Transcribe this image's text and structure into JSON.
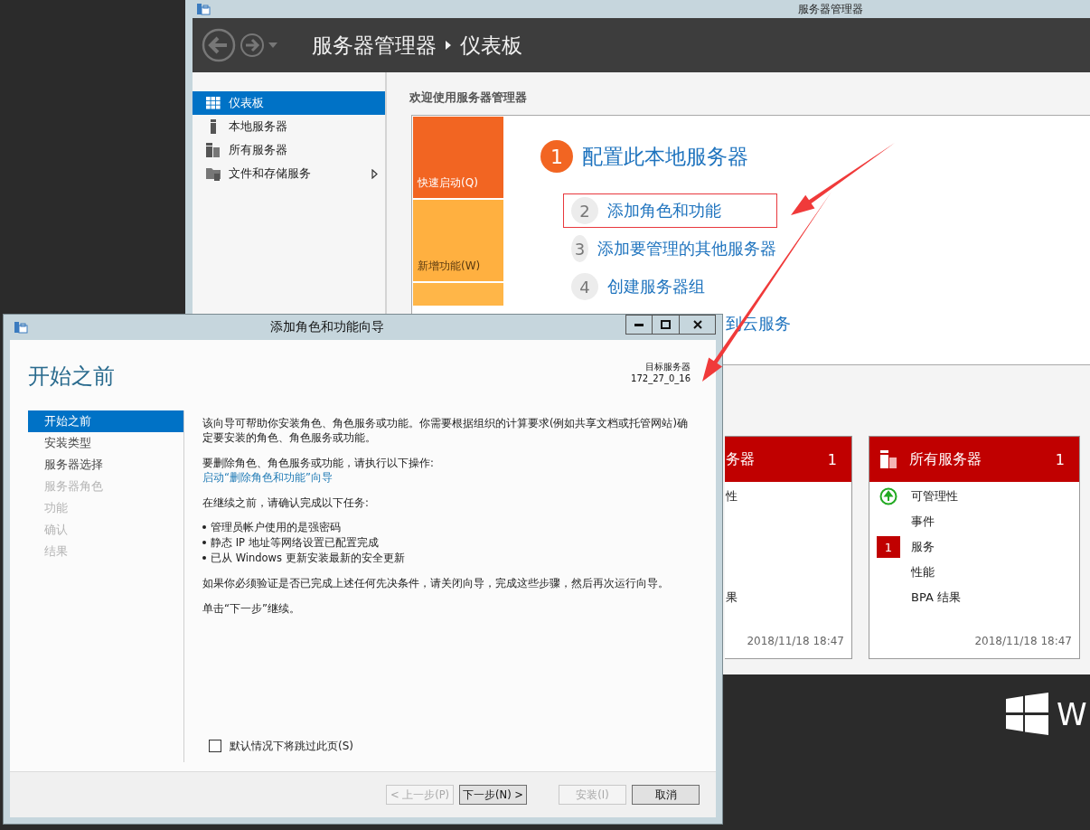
{
  "server_manager": {
    "title": "服务器管理器",
    "breadcrumb": [
      "服务器管理器",
      "仪表板"
    ],
    "sidebar": {
      "items": [
        {
          "label": "仪表板",
          "selected": true,
          "expandable": false
        },
        {
          "label": "本地服务器",
          "selected": false,
          "expandable": false
        },
        {
          "label": "所有服务器",
          "selected": false,
          "expandable": false
        },
        {
          "label": "文件和存储服务",
          "selected": false,
          "expandable": true
        }
      ]
    },
    "welcome_title": "欢迎使用服务器管理器",
    "quick_start": {
      "tiles": [
        {
          "label": "快速启动(Q)",
          "color": "#f26522"
        },
        {
          "label": "新增功能(W)",
          "color": "#ffb040"
        },
        {
          "color": "#ffb648",
          "partial": true
        }
      ],
      "steps": [
        {
          "kind": "primary",
          "number": "1",
          "label": "配置此本地服务器",
          "highlighted": false
        },
        {
          "kind": "secondary",
          "number": "2",
          "label": "添加角色和功能",
          "highlighted": true
        },
        {
          "kind": "secondary",
          "number": "3",
          "label": "添加要管理的其他服务器",
          "highlighted": false
        },
        {
          "kind": "secondary",
          "number": "4",
          "label": "创建服务器组",
          "highlighted": false
        },
        {
          "kind": "covered",
          "label": "到云服务",
          "highlighted": false
        }
      ]
    },
    "tiles": [
      {
        "title": "务器",
        "count": "1",
        "partial": true,
        "items": [
          {
            "kind": "text",
            "label": "性"
          },
          {
            "kind": "blank"
          },
          {
            "kind": "blank"
          },
          {
            "kind": "blank"
          },
          {
            "kind": "text",
            "label": "果"
          }
        ],
        "time": "2018/11/18 18:47"
      },
      {
        "title": "所有服务器",
        "count": "1",
        "partial": false,
        "items": [
          {
            "kind": "status",
            "label": "可管理性"
          },
          {
            "kind": "text",
            "label": "事件"
          },
          {
            "kind": "badge",
            "badge": "1",
            "label": "服务"
          },
          {
            "kind": "text",
            "label": "性能"
          },
          {
            "kind": "text",
            "label": "BPA 结果"
          }
        ],
        "time": "2018/11/18 18:47"
      }
    ]
  },
  "wizard": {
    "title": "添加角色和功能向导",
    "heading": "开始之前",
    "target_label": "目标服务器",
    "target_value": "172_27_0_16",
    "steps": [
      {
        "label": "开始之前",
        "selected": true,
        "disabled": false
      },
      {
        "label": "安装类型",
        "selected": false,
        "disabled": false
      },
      {
        "label": "服务器选择",
        "selected": false,
        "disabled": false
      },
      {
        "label": "服务器角色",
        "selected": false,
        "disabled": true
      },
      {
        "label": "功能",
        "selected": false,
        "disabled": true
      },
      {
        "label": "确认",
        "selected": false,
        "disabled": true
      },
      {
        "label": "结果",
        "selected": false,
        "disabled": true
      }
    ],
    "content": [
      {
        "kind": "paragraph",
        "text": "该向导可帮助你安装角色、角色服务或功能。你需要根据组织的计算要求(例如共享文档或托管网站)确定要安装的角色、角色服务或功能。"
      },
      {
        "kind": "paragraph",
        "text": "要删除角色、角色服务或功能，请执行以下操作:"
      },
      {
        "kind": "link",
        "text": "启动“删除角色和功能”向导"
      },
      {
        "kind": "paragraph",
        "text": "在继续之前，请确认完成以下任务:"
      },
      {
        "kind": "bullets",
        "items": [
          "管理员帐户使用的是强密码",
          "静态 IP 地址等网络设置已配置完成",
          "已从 Windows 更新安装最新的安全更新"
        ]
      },
      {
        "kind": "paragraph",
        "text": "如果你必须验证是否已完成上述任何先决条件，请关闭向导，完成这些步骤，然后再次运行向导。"
      },
      {
        "kind": "paragraph",
        "text": "单击“下一步”继续。"
      }
    ],
    "skip_checkbox": {
      "label": "默认情况下将跳过此页(S)",
      "checked": false
    },
    "buttons": [
      {
        "label": "< 上一步(P)",
        "disabled": true
      },
      {
        "label": "下一步(N) >",
        "disabled": false
      },
      {
        "label": "安装(I)",
        "disabled": true
      },
      {
        "label": "取消",
        "disabled": false
      }
    ]
  },
  "desktop": {
    "brand_text": "W"
  }
}
